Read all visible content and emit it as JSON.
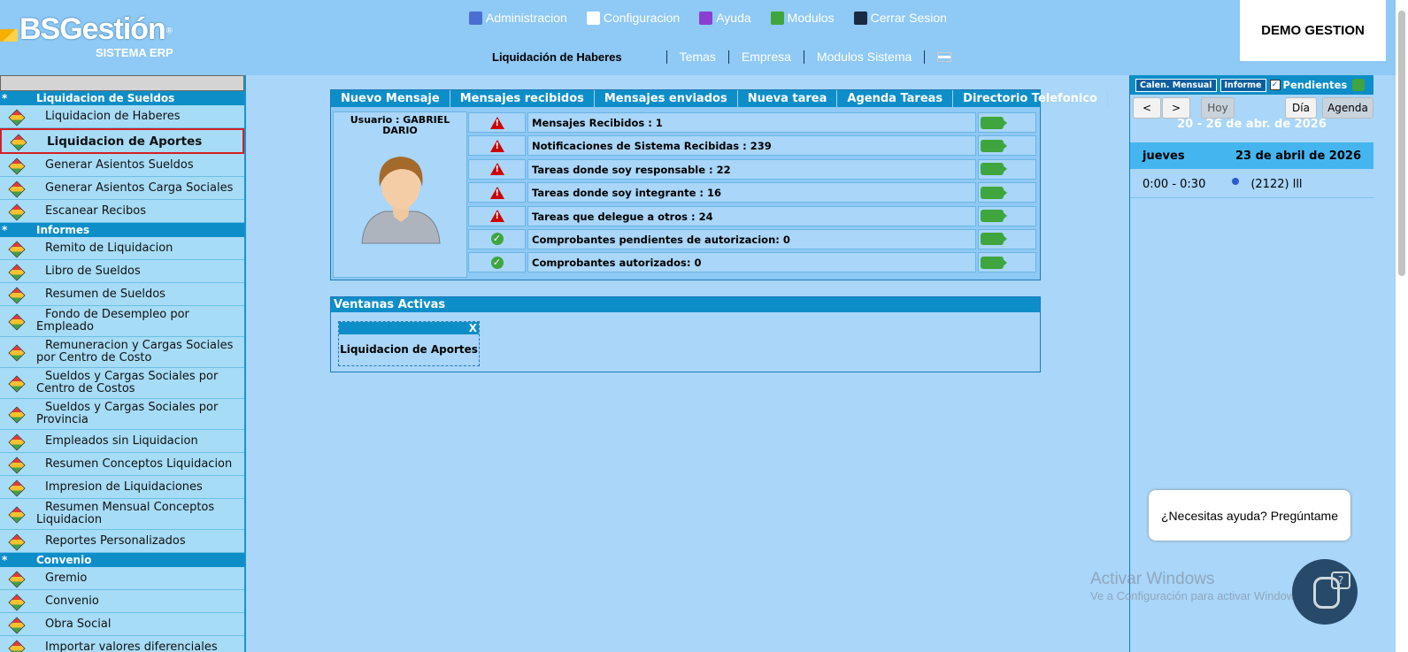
{
  "brand": {
    "name": "BSGestión",
    "registered": "®",
    "subtitle": "SISTEMA ERP"
  },
  "topnav": [
    {
      "label": "Administracion",
      "icon": "admin-icon"
    },
    {
      "label": "Configuracion",
      "icon": "config-icon"
    },
    {
      "label": "Ayuda",
      "icon": "help-icon"
    },
    {
      "label": "Modulos",
      "icon": "modules-icon"
    },
    {
      "label": "Cerrar Sesion",
      "icon": "logout-icon"
    }
  ],
  "subnav": {
    "current": "Liquidación de Haberes",
    "links": [
      "Temas",
      "Empresa",
      "Modulos Sistema"
    ]
  },
  "company": "DEMO GESTION",
  "sidebar": {
    "sections": [
      {
        "title": "Liquidacion de Sueldos",
        "items": [
          "Liquidacion de Haberes",
          "Liquidacion de Aportes",
          "Generar Asientos Sueldos",
          "Generar Asientos Carga Sociales",
          "Escanear Recibos"
        ]
      },
      {
        "title": "Informes",
        "items": [
          "Remito de Liquidacion",
          "Libro de Sueldos",
          "Resumen de Sueldos",
          "Fondo de Desempleo por Empleado",
          "Remuneracion y Cargas Sociales por Centro de Costo",
          "Sueldos y Cargas Sociales por Centro de Costos",
          "Sueldos y Cargas Sociales por Provincia",
          "Empleados sin Liquidacion",
          "Resumen Conceptos Liquidacion",
          "Impresion de Liquidaciones",
          "Resumen Mensual Conceptos Liquidacion",
          "Reportes Personalizados"
        ]
      },
      {
        "title": "Convenio",
        "items": [
          "Gremio",
          "Convenio",
          "Obra Social",
          "Importar valores diferenciales"
        ]
      }
    ],
    "star": "*"
  },
  "messages": {
    "tabs": [
      "Nuevo Mensaje",
      "Mensajes recibidos",
      "Mensajes enviados",
      "Nueva tarea",
      "Agenda Tareas",
      "Directorio Telefonico"
    ],
    "user_label": "Usuario : GABRIEL DARIO",
    "rows": [
      {
        "text": "Mensajes Recibidos : 1",
        "status": "warning"
      },
      {
        "text": "Notificaciones de Sistema Recibidas : 239",
        "status": "warning"
      },
      {
        "text": "Tareas donde soy responsable : 22",
        "status": "warning"
      },
      {
        "text": "Tareas donde soy integrante : 16",
        "status": "warning"
      },
      {
        "text": "Tareas que delegue a otros : 24",
        "status": "warning"
      },
      {
        "text": "Comprobantes pendientes de autorizacion: 0",
        "status": "ok"
      },
      {
        "text": "Comprobantes autorizados: 0",
        "status": "ok"
      }
    ]
  },
  "ventanas": {
    "title": "Ventanas Activas",
    "close": "X",
    "window": "Liquidacion de Aportes"
  },
  "calendar": {
    "btn_mensual": "Calen. Mensual",
    "btn_informe": "Informe",
    "pendientes": "Pendientes",
    "check": "✓",
    "prev": "<",
    "next": ">",
    "today": "Hoy",
    "day": "Día",
    "agenda": "Agenda",
    "range": "20 - 26 de abr. de 2026",
    "weekday": "jueves",
    "date": "23 de abril de 2026",
    "event_time": "0:00 - 0:30",
    "event_title": "(2122) lll"
  },
  "chat": {
    "prompt": "¿Necesitas ayuda? Pregúntame",
    "bot_symbol": "?"
  },
  "watermark": {
    "title": "Activar Windows",
    "subtitle": "Ve a Configuración para activar Windows."
  },
  "colors": {
    "header": "#8fc9f5",
    "section": "#0e8ec8",
    "selected_border": "#d32026"
  }
}
